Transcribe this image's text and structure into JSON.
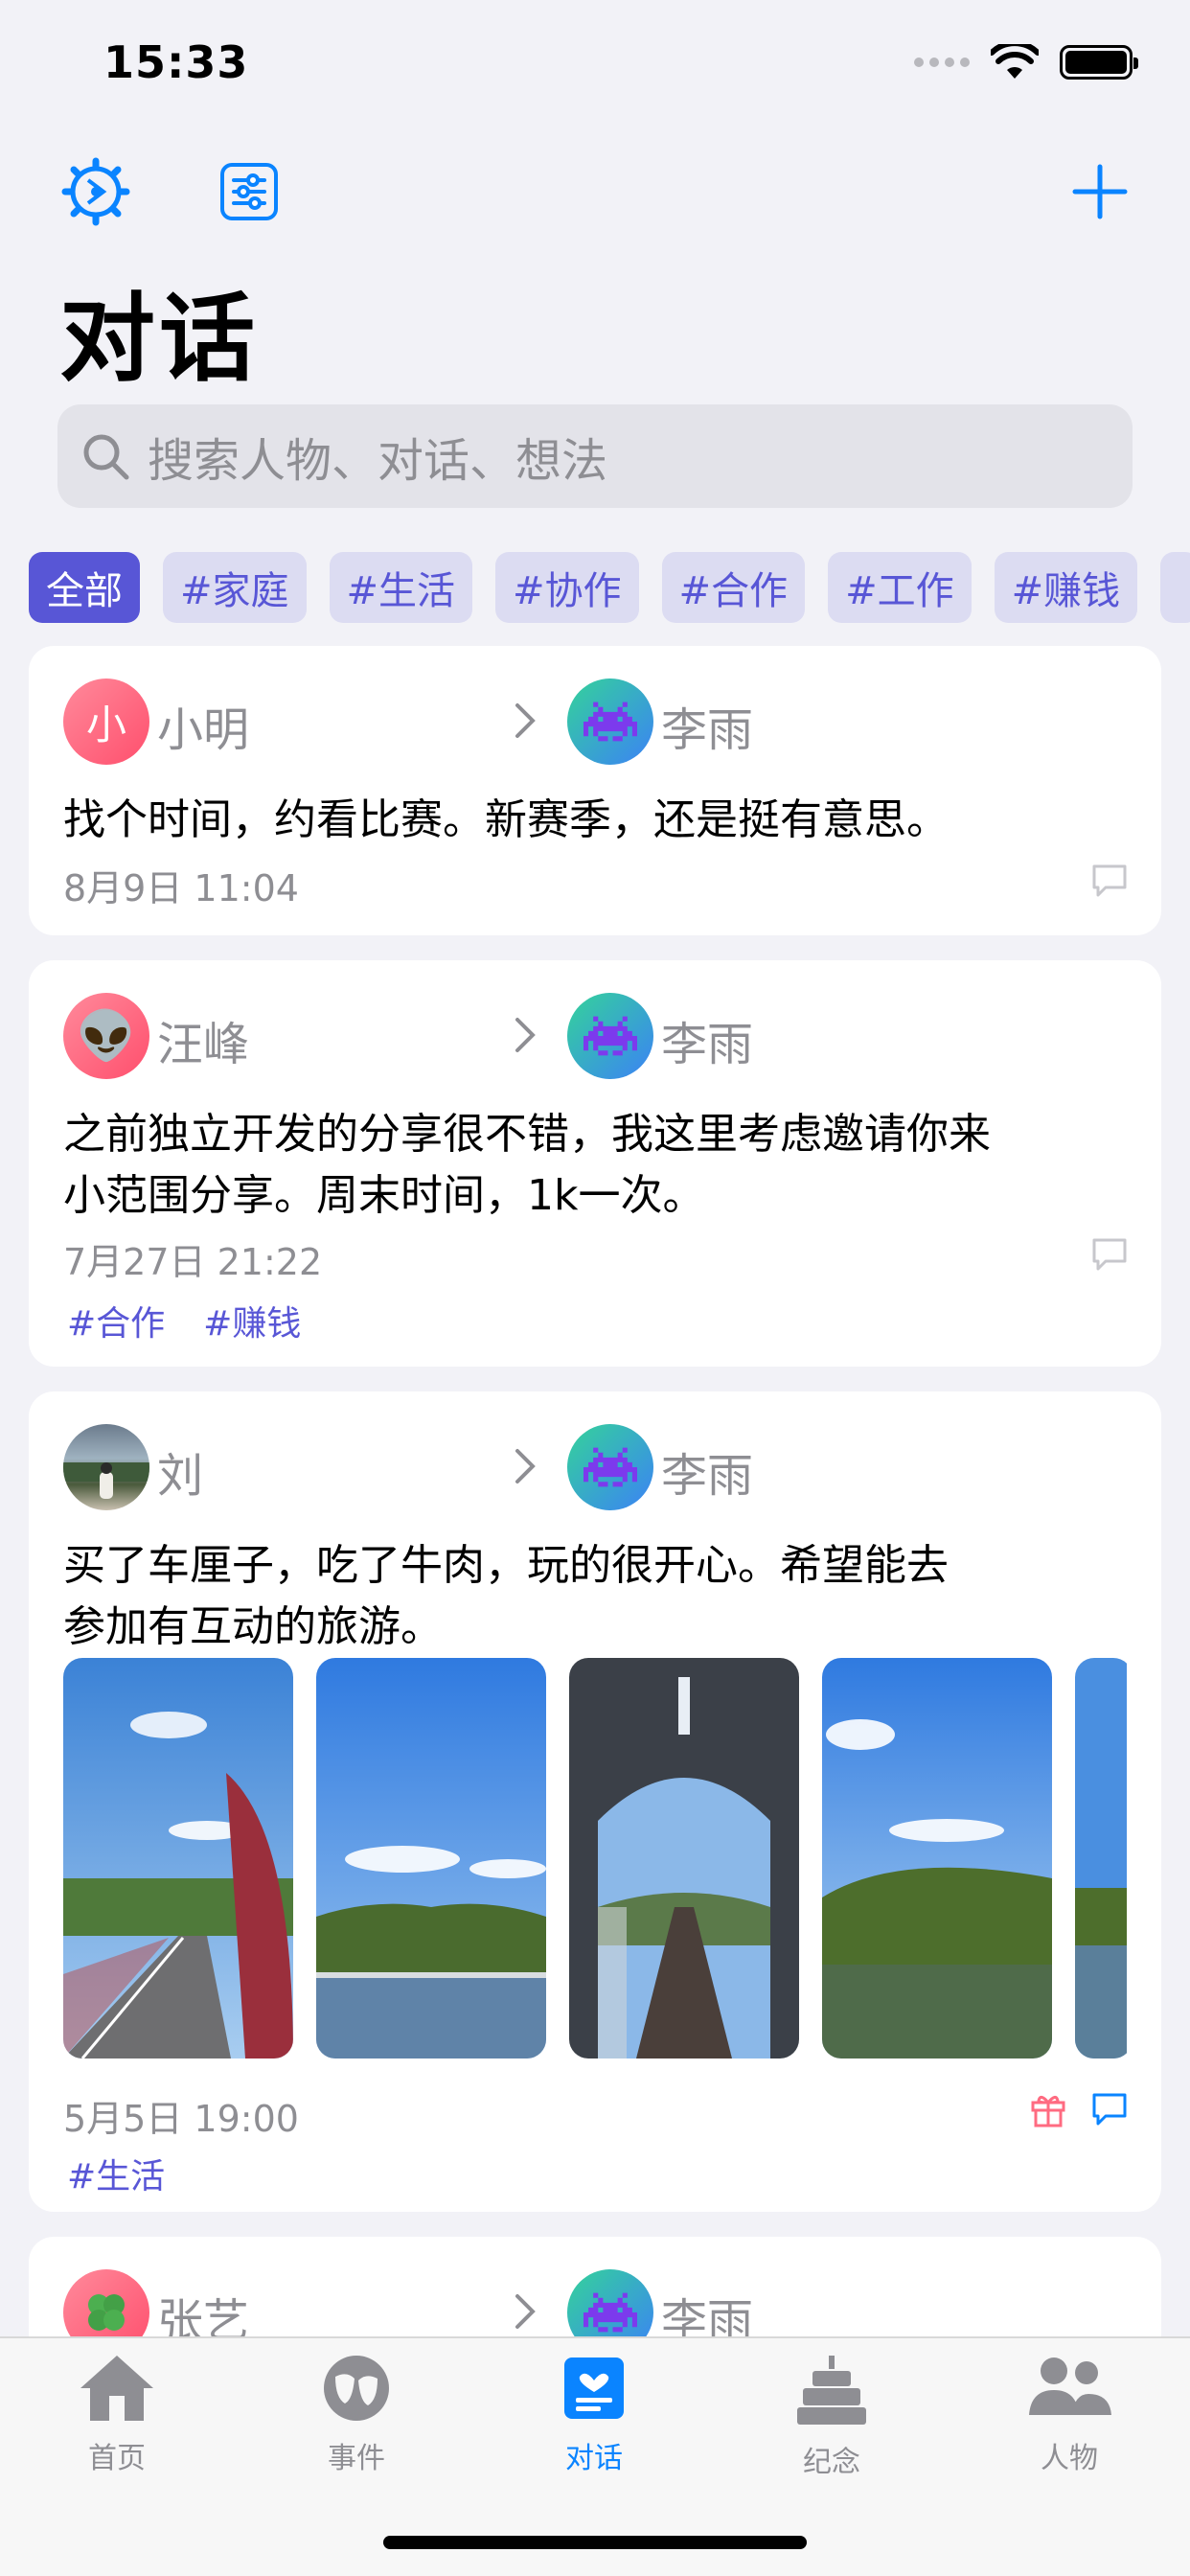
{
  "status_bar": {
    "time": "15:33"
  },
  "header": {
    "title": "对话",
    "search_placeholder": "搜索人物、对话、想法"
  },
  "filters": [
    "全部",
    "#家庭",
    "#生活",
    "#协作",
    "#合作",
    "#工作",
    "#赚钱"
  ],
  "conversations": [
    {
      "from": {
        "name": "小明",
        "avatar_text": "小"
      },
      "to": {
        "name": "李雨"
      },
      "text_lines": [
        "找个时间，约看比赛。新赛季，还是挺有意思。"
      ],
      "date": "8月9日 11:04",
      "tags": []
    },
    {
      "from": {
        "name": "汪峰",
        "avatar_text": "👽"
      },
      "to": {
        "name": "李雨"
      },
      "text_lines": [
        "之前独立开发的分享很不错，我这里考虑邀请你来",
        "小范围分享。周末时间，1k一次。"
      ],
      "date": "7月27日 21:22",
      "tags": [
        "#合作",
        "#赚钱"
      ]
    },
    {
      "from": {
        "name": "刘"
      },
      "to": {
        "name": "李雨"
      },
      "text_lines": [
        "买了车厘子，吃了牛肉，玩的很开心。希望能去",
        "参加有互动的旅游。"
      ],
      "date": "5月5日 19:00",
      "tags": [
        "#生活"
      ]
    },
    {
      "from": {
        "name": "张艺"
      },
      "to": {
        "name": "李雨"
      }
    }
  ],
  "tabs": [
    {
      "label": "首页",
      "icon": "house-icon"
    },
    {
      "label": "事件",
      "icon": "theater-masks-icon"
    },
    {
      "label": "对话",
      "icon": "message-heart-icon",
      "active": true
    },
    {
      "label": "纪念",
      "icon": "birthday-cake-icon"
    },
    {
      "label": "人物",
      "icon": "people-icon"
    }
  ],
  "colors": {
    "accent": "#0a84ff",
    "chip_active": "#5856d6",
    "chip_bg": "#dcdcf2",
    "background": "#f2f2f7"
  }
}
